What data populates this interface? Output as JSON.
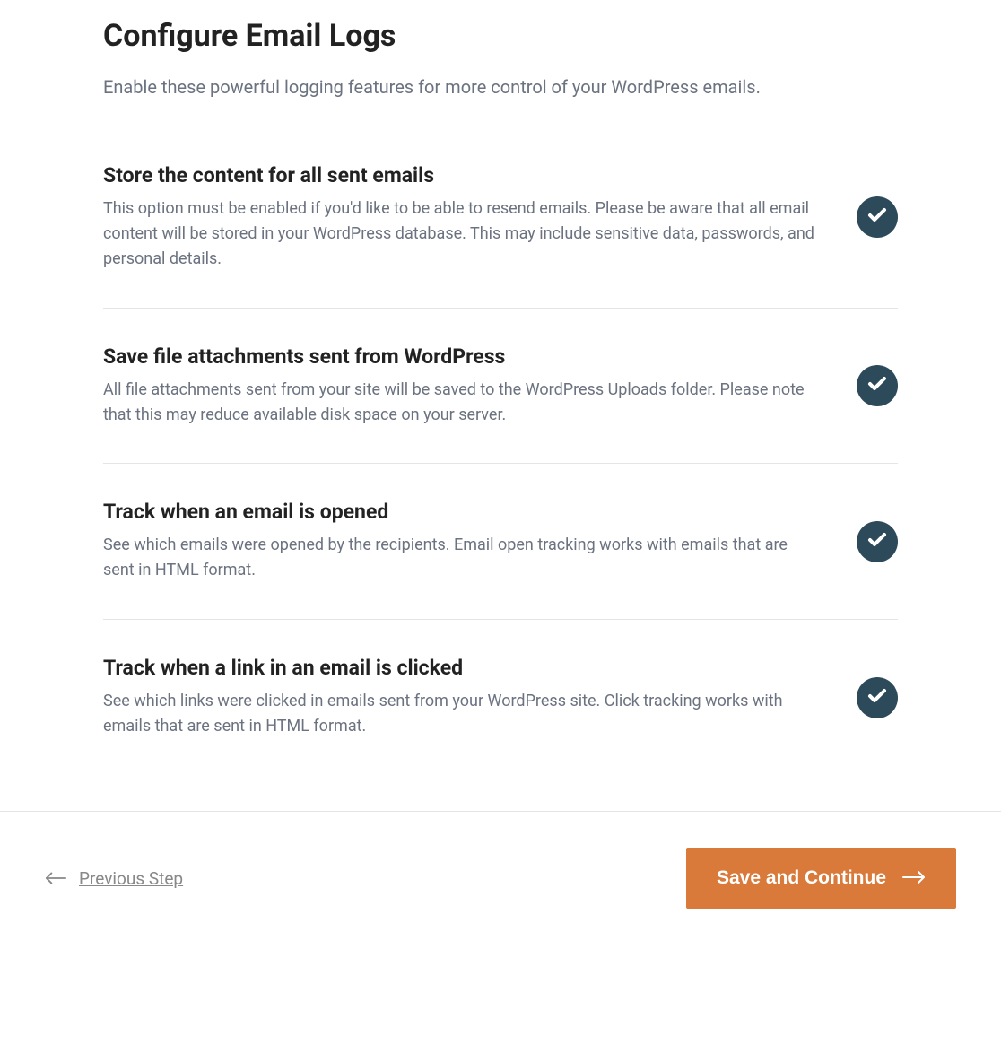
{
  "header": {
    "title": "Configure Email Logs",
    "subtitle": "Enable these powerful logging features for more control of your WordPress emails."
  },
  "options": [
    {
      "title": "Store the content for all sent emails",
      "desc": "This option must be enabled if you'd like to be able to resend emails. Please be aware that all email content will be stored in your WordPress database. This may include sensitive data, passwords, and personal details.",
      "enabled": true
    },
    {
      "title": "Save file attachments sent from WordPress",
      "desc": "All file attachments sent from your site will be saved to the WordPress Uploads folder. Please note that this may reduce available disk space on your server.",
      "enabled": true
    },
    {
      "title": "Track when an email is opened",
      "desc": "See which emails were opened by the recipients. Email open tracking works with emails that are sent in HTML format.",
      "enabled": true
    },
    {
      "title": "Track when a link in an email is clicked",
      "desc": "See which links were clicked in emails sent from your WordPress site. Click tracking works with emails that are sent in HTML format.",
      "enabled": true
    }
  ],
  "footer": {
    "previous": "Previous Step",
    "save": "Save and Continue"
  },
  "colors": {
    "accent": "#d97a3a",
    "toggle": "#2d4a5a"
  }
}
